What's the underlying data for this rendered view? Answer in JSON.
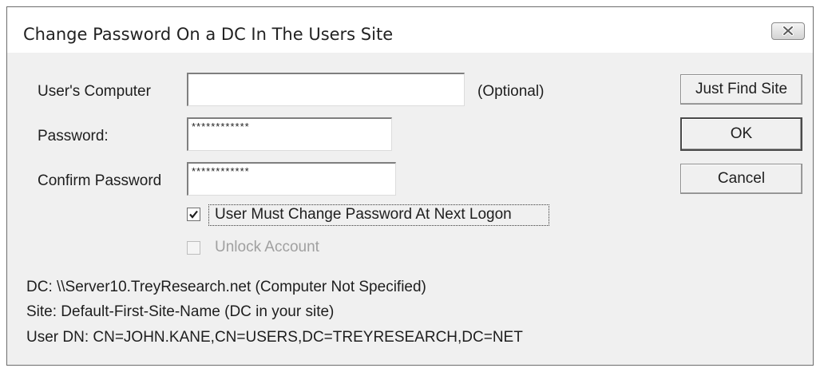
{
  "window": {
    "title": "Change Password On a DC In The Users Site",
    "close_icon": "close-icon"
  },
  "form": {
    "users_computer_label": "User's Computer",
    "users_computer_value": "",
    "optional_label": "(Optional)",
    "password_label": "Password:",
    "password_value": "************",
    "confirm_password_label": "Confirm Password",
    "confirm_password_value": "************",
    "must_change_label": "User Must Change Password At Next Logon",
    "must_change_checked": true,
    "unlock_label": "Unlock Account",
    "unlock_checked": false,
    "unlock_enabled": false
  },
  "buttons": {
    "just_find_site": "Just Find Site",
    "ok": "OK",
    "cancel": "Cancel"
  },
  "info": {
    "dc": "DC: \\\\Server10.TreyResearch.net (Computer Not Specified)",
    "site": "Site: Default-First-Site-Name (DC in your site)",
    "user_dn": "User DN: CN=JOHN.KANE,CN=USERS,DC=TREYRESEARCH,DC=NET"
  }
}
